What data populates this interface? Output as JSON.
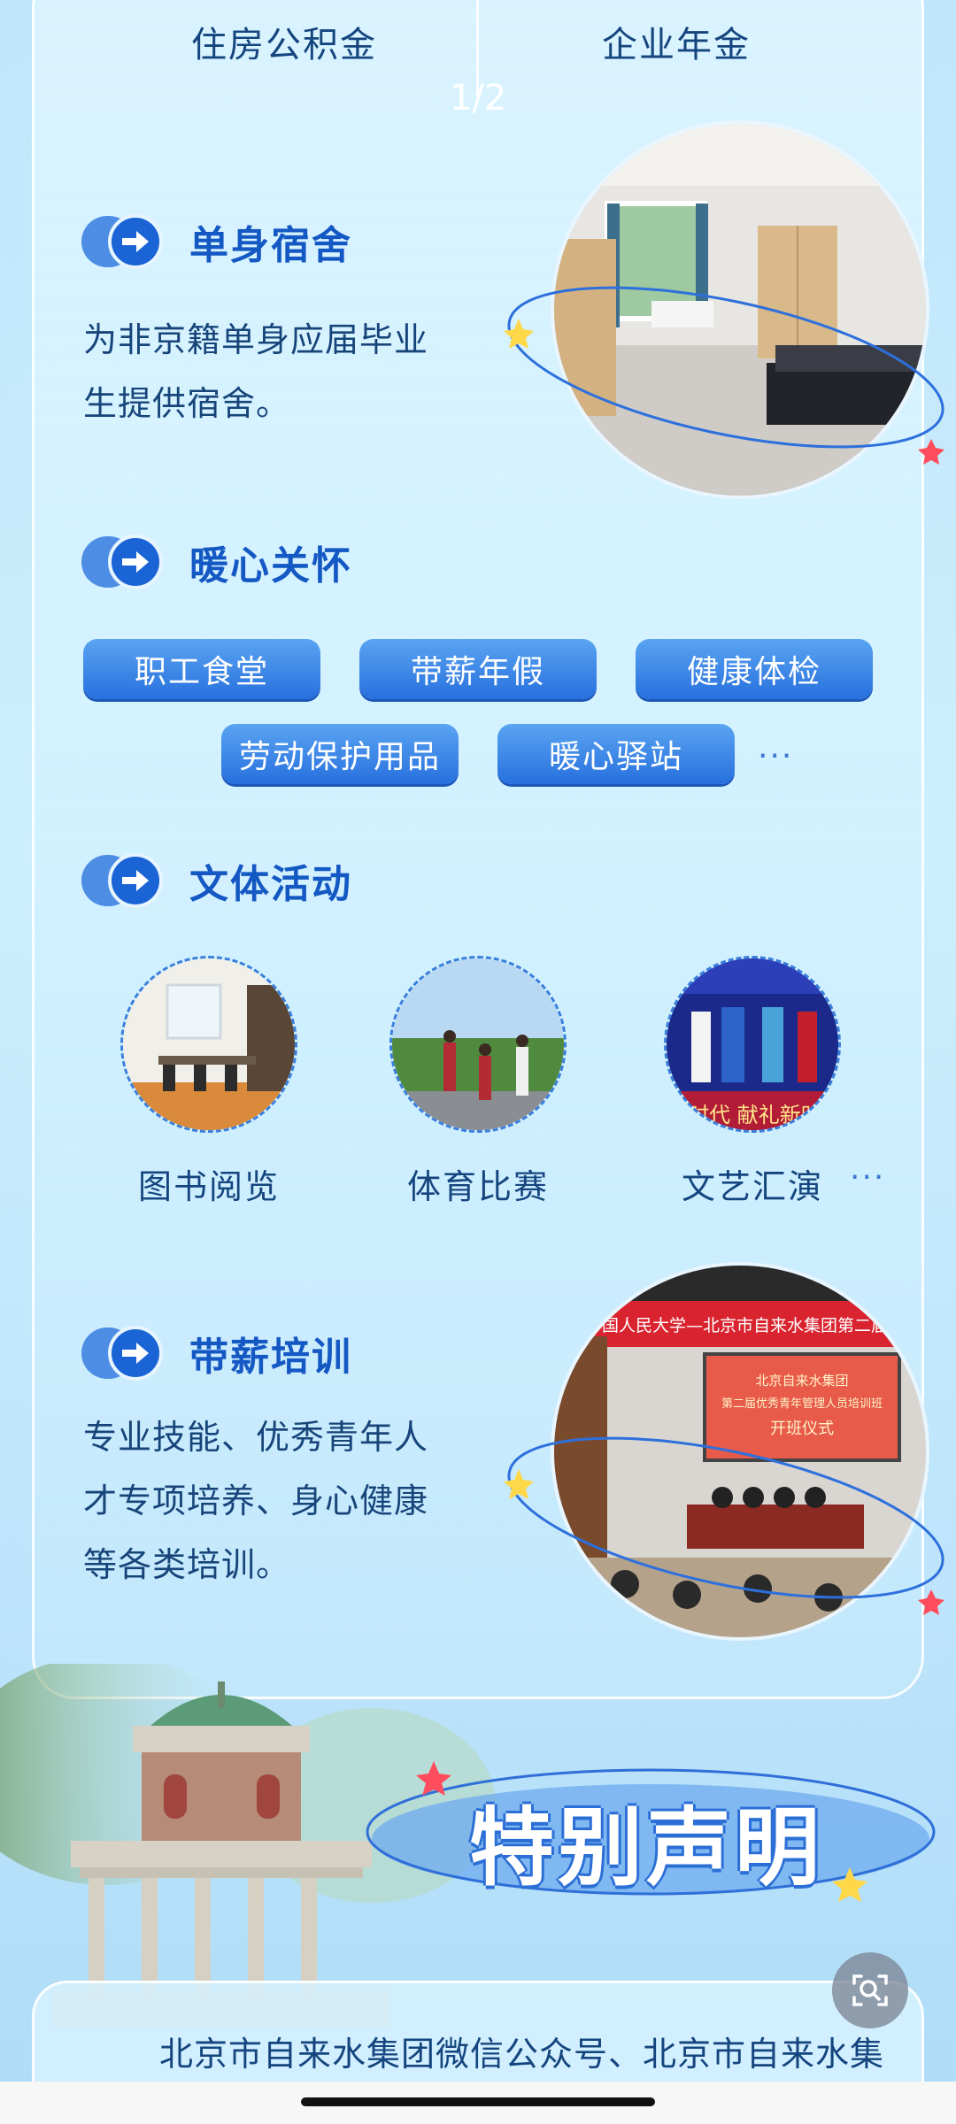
{
  "top_tabs": {
    "left": "住房公积金",
    "right": "企业年金"
  },
  "pager": "1/2",
  "sections": {
    "dorm": {
      "title": "单身宿舍",
      "lines": [
        "为非京籍单身应届毕业",
        "生提供宿舍。"
      ]
    },
    "care": {
      "title": "暖心关怀",
      "tags": [
        "职工食堂",
        "带薪年假",
        "健康体检",
        "劳动保护用品",
        "暖心驿站"
      ],
      "more": "···"
    },
    "culture": {
      "title": "文体活动",
      "activities": [
        "图书阅览",
        "体育比赛",
        "文艺汇演"
      ],
      "more": "···"
    },
    "training": {
      "title": "带薪培训",
      "lines": [
        "专业技能、优秀青年人",
        "才专项培养、身心健康",
        "等各类培训。"
      ],
      "photo_banner": "中国人民大学—北京市自来水集团第二届优秀",
      "photo_screen": [
        "北京自来水集团",
        "第二届优秀青年管理人员培训班",
        "开班仪式"
      ]
    }
  },
  "special_statement": "特别声明",
  "bottom_text": "北京市自来水集团微信公众号、北京市自来水集",
  "stage_banner": "时代 献礼新时",
  "icons": {
    "arrow": "arrow-right-icon",
    "lens": "visual-search-icon"
  },
  "colors": {
    "accent": "#1458c4",
    "tag": "#2f78e0",
    "text": "#15457e"
  }
}
